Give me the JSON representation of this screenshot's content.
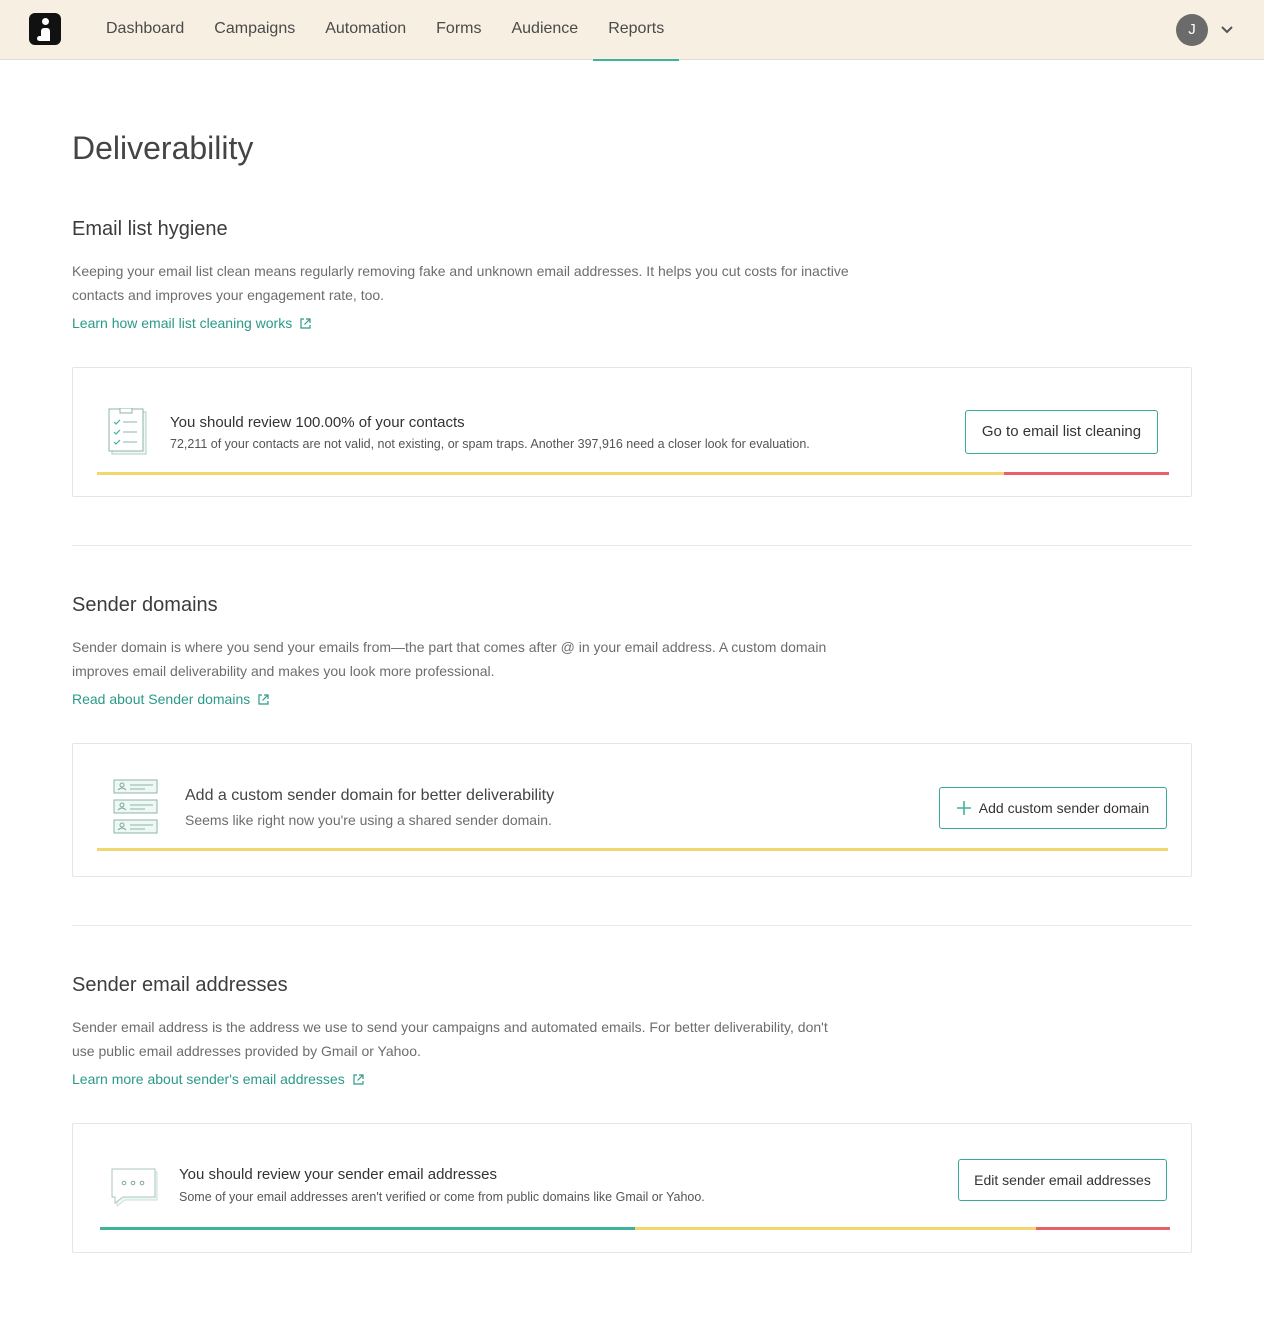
{
  "nav": {
    "items": [
      {
        "label": "Dashboard"
      },
      {
        "label": "Campaigns"
      },
      {
        "label": "Automation"
      },
      {
        "label": "Forms"
      },
      {
        "label": "Audience"
      },
      {
        "label": "Reports"
      }
    ],
    "active": "Reports",
    "avatar_initial": "J"
  },
  "page": {
    "title": "Deliverability"
  },
  "hygiene": {
    "heading": "Email list hygiene",
    "description": "Keeping your email list clean means regularly removing fake and unknown email addresses. It helps you cut costs for inactive contacts and improves your engagement rate, too.",
    "link": "Learn how email list cleaning works",
    "card": {
      "title": "You should review 100.00% of your contacts",
      "subtitle": "72,211 of your contacts are not valid, not existing, or spam traps. Another 397,916 need a closer look for evaluation.",
      "button": "Go to email list cleaning",
      "bar_segments": [
        {
          "color": "#f2d76e",
          "fraction": 0.846
        },
        {
          "color": "#e8616a",
          "fraction": 0.154
        }
      ]
    }
  },
  "domains": {
    "heading": "Sender domains",
    "description": "Sender domain is where you send your emails from—the part that comes after @ in your email address. A custom domain improves email deliverability and makes you look more professional.",
    "link": "Read about Sender domains",
    "card": {
      "title": "Add a custom sender domain for better deliverability",
      "subtitle": "Seems like right now you're using a shared sender domain.",
      "button": "Add custom sender domain",
      "bar_segments": [
        {
          "color": "#f2d76e",
          "fraction": 1.0
        }
      ]
    }
  },
  "addresses": {
    "heading": "Sender email addresses",
    "description": "Sender email address is the address we use to send your campaigns and automated emails. For better deliverability, don't use public email addresses provided by Gmail or Yahoo.",
    "link": "Learn more about sender's email addresses",
    "card": {
      "title": "You should review your sender email addresses",
      "subtitle": "Some of your email addresses aren't verified or come from public domains like Gmail or Yahoo.",
      "button": "Edit sender email addresses",
      "bar_segments": [
        {
          "color": "#3fb29c",
          "fraction": 0.5
        },
        {
          "color": "#f2d76e",
          "fraction": 0.375
        },
        {
          "color": "#e8616a",
          "fraction": 0.125
        }
      ]
    }
  }
}
